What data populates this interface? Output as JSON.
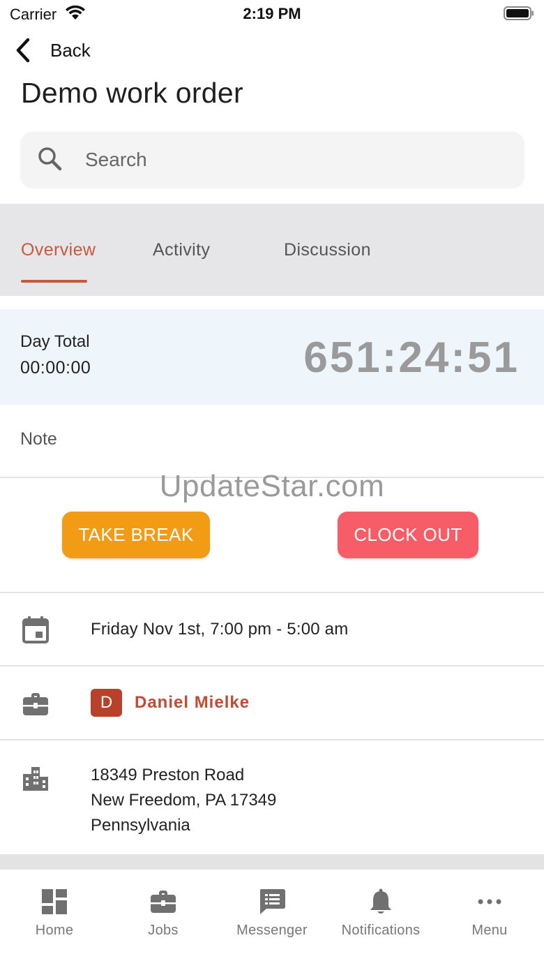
{
  "status_bar": {
    "carrier": "Carrier",
    "time": "2:19 PM"
  },
  "nav": {
    "back_label": "Back"
  },
  "page": {
    "title": "Demo work order"
  },
  "search": {
    "placeholder": "Search"
  },
  "tabs": [
    {
      "label": "Overview",
      "active": true
    },
    {
      "label": "Activity",
      "active": false
    },
    {
      "label": "Discussion",
      "active": false
    }
  ],
  "timer": {
    "day_total_label": "Day Total",
    "day_total_value": "00:00:00",
    "elapsed": "651:24:51"
  },
  "note": {
    "label": "Note"
  },
  "watermark": "UpdateStar.com",
  "actions": {
    "take_break": "TAKE BREAK",
    "clock_out": "CLOCK OUT"
  },
  "details": {
    "schedule": "Friday Nov 1st, 7:00 pm - 5:00 am",
    "client_initial": "D",
    "client_name": "Daniel Mielke",
    "address_line1": "18349 Preston Road",
    "address_line2": "New Freedom, PA 17349",
    "address_line3": "Pennsylvania"
  },
  "bottom_nav": [
    {
      "label": "Home",
      "icon": "dashboard-icon"
    },
    {
      "label": "Jobs",
      "icon": "briefcase-icon"
    },
    {
      "label": "Messenger",
      "icon": "message-icon"
    },
    {
      "label": "Notifications",
      "icon": "bell-icon"
    },
    {
      "label": "Menu",
      "icon": "more-icon"
    }
  ],
  "colors": {
    "accent": "#c8593e",
    "take_break": "#f29c15",
    "clock_out": "#f65d67",
    "client": "#c24a33",
    "timer_panel": "#eef5fb"
  }
}
